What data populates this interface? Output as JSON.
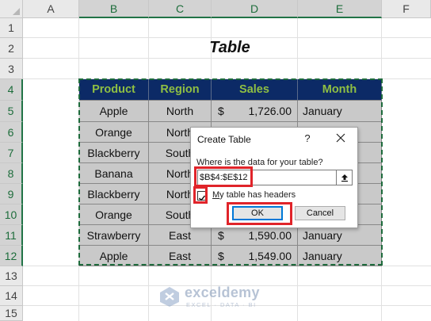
{
  "sheet": {
    "columns": [
      "A",
      "B",
      "C",
      "D",
      "E",
      "F"
    ],
    "rows": [
      "1",
      "2",
      "3",
      "4",
      "5",
      "6",
      "7",
      "8",
      "9",
      "10",
      "11",
      "12",
      "13",
      "14",
      "15"
    ],
    "title": "Table"
  },
  "table": {
    "headers": [
      "Product",
      "Region",
      "Sales",
      "Month"
    ],
    "currency_symbol": "$",
    "rows": [
      {
        "product": "Apple",
        "region": "North",
        "sales": "1,726.00",
        "month": "January"
      },
      {
        "product": "Orange",
        "region": "North",
        "sales": "",
        "month": ""
      },
      {
        "product": "Blackberry",
        "region": "South",
        "sales": "",
        "month": ""
      },
      {
        "product": "Banana",
        "region": "North",
        "sales": "",
        "month": ""
      },
      {
        "product": "Blackberry",
        "region": "North",
        "sales": "",
        "month": ""
      },
      {
        "product": "Orange",
        "region": "South",
        "sales": "",
        "month": ""
      },
      {
        "product": "Strawberry",
        "region": "East",
        "sales": "1,590.00",
        "month": "January"
      },
      {
        "product": "Apple",
        "region": "East",
        "sales": "1,549.00",
        "month": "January"
      }
    ]
  },
  "dialog": {
    "title": "Create Table",
    "help": "?",
    "prompt": "Where is the data for your table?",
    "range_value": "$B$4:$E$12",
    "headers_checkbox_label_underlined": "M",
    "headers_checkbox_label_rest": "y table has headers",
    "headers_checked": true,
    "ok_label": "OK",
    "cancel_label": "Cancel"
  },
  "watermark": {
    "name": "exceldemy",
    "tagline": "EXCEL · DATA · BI"
  },
  "colors": {
    "header_bg": "#0c2a66",
    "header_text": "#8fbf43",
    "cell_bg": "#c9c9c9",
    "annotation_red": "#e0242a",
    "selection_green": "#1e6b3c"
  }
}
